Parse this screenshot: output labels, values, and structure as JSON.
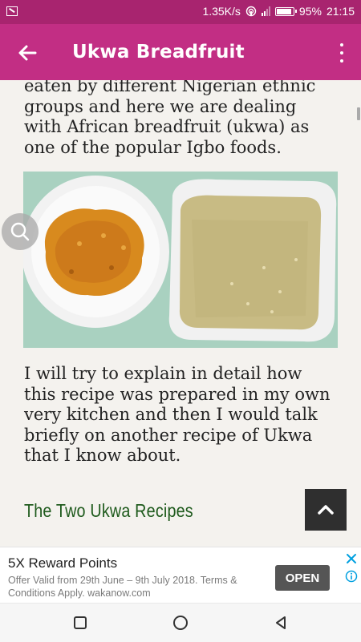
{
  "status_bar": {
    "speed": "1.35K/s",
    "battery": "95%",
    "time": "21:15"
  },
  "app_bar": {
    "title": "Ukwa Breadfruit"
  },
  "article": {
    "paragraph_1": "eaten by different Nigerian ethnic groups and here we are dealing with African breadfruit (ukwa) as one of the popular Igbo foods.",
    "paragraph_2": "I will try to explain in detail how this recipe was prepared in my own very kitchen and then I would talk briefly on another recipe of Ukwa that I know about.",
    "heading": "The Two Ukwa Recipes"
  },
  "ad": {
    "title": "5X Reward Points",
    "text": "Offer Valid from 29th June – 9th July 2018. Terms & Conditions Apply. wakanow.com",
    "button": "OPEN"
  },
  "icons": {
    "back": "arrow-left-icon",
    "menu": "more-vert-icon",
    "search": "search-icon",
    "top": "chevron-up-icon",
    "close": "close-icon",
    "info": "info-icon"
  },
  "colors": {
    "status_bar": "#a8246f",
    "app_bar": "#c22e84",
    "heading": "#1e5a1c",
    "ad_accent": "#00a0e0"
  }
}
